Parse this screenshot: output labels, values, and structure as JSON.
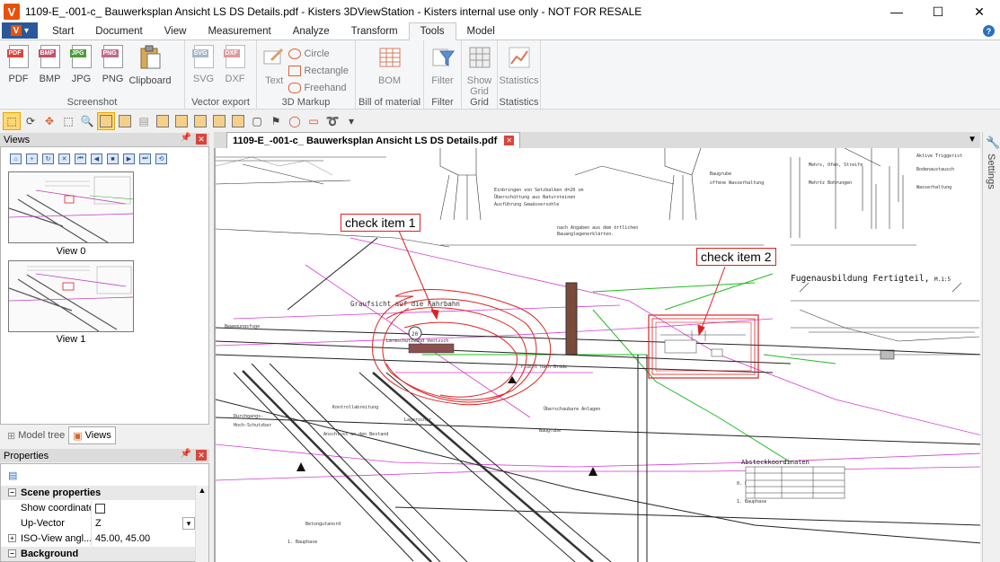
{
  "window": {
    "title": "1109-E_-001-c_ Bauwerksplan Ansicht  LS  DS  Details.pdf - Kisters 3DViewStation - Kisters internal use only - NOT FOR RESALE",
    "logo": "V",
    "minimize": "—",
    "maximize": "☐",
    "close": "✕"
  },
  "ribbon": {
    "tabs": [
      "Start",
      "Document",
      "View",
      "Measurement",
      "Analyze",
      "Transform",
      "Tools",
      "Model"
    ],
    "active_tab": "Tools",
    "groups": {
      "screenshot": {
        "label": "Screenshot",
        "buttons": [
          "PDF",
          "BMP",
          "JPG",
          "PNG",
          "Clipboard"
        ]
      },
      "vector_export": {
        "label": "Vector export",
        "buttons": [
          "SVG",
          "DXF"
        ]
      },
      "markup": {
        "label": "3D Markup",
        "text": "Text",
        "circle": "Circle",
        "rectangle": "Rectangle",
        "freehand": "Freehand"
      },
      "bom": {
        "label": "Bill of material",
        "button": "BOM"
      },
      "filter": {
        "label": "Filter",
        "button": "Filter"
      },
      "grid": {
        "label": "Grid",
        "button": "Show Grid"
      },
      "statistics": {
        "label": "Statistics",
        "button": "Statistics"
      }
    },
    "file_tags": {
      "pdf": "PDF",
      "bmp": "BMP",
      "jpg": "JPG",
      "png": "PNG",
      "svg": "SVG",
      "dxf": "DXF"
    },
    "help": "?"
  },
  "views_panel": {
    "title": "Views",
    "items": [
      {
        "label": "View 0"
      },
      {
        "label": "View 1"
      }
    ]
  },
  "panel_tabs": {
    "model_tree": "Model tree",
    "views": "Views"
  },
  "properties": {
    "title": "Properties",
    "rows": [
      {
        "key": "Scene properties",
        "value": "",
        "type": "category"
      },
      {
        "key": "Show coordinate ...",
        "value": "",
        "type": "checkbox"
      },
      {
        "key": "Up-Vector",
        "value": "Z",
        "type": "dropdown"
      },
      {
        "key": "ISO-View angl...",
        "value": "45.00, 45.00",
        "type": "expandable"
      },
      {
        "key": "Background",
        "value": "",
        "type": "category"
      }
    ]
  },
  "document": {
    "tab_title": "1109-E_-001-c_ Bauwerksplan Ansicht  LS  DS  Details.pdf",
    "annotations": [
      "check item 1",
      "check item 2"
    ],
    "drawing_texts": {
      "fahrbahn": "Graufsicht auf die Fahrbahn",
      "fugen": "Fugenausbildung  Fertigteil,",
      "fugen_scale": "M.1:5",
      "absteck": "Absteckkoordinaten",
      "settings": "Settings"
    }
  },
  "colors": {
    "accent": "#2b579a",
    "logo": "#e8510a",
    "markup": "#d22222",
    "close": "#d9453b"
  }
}
